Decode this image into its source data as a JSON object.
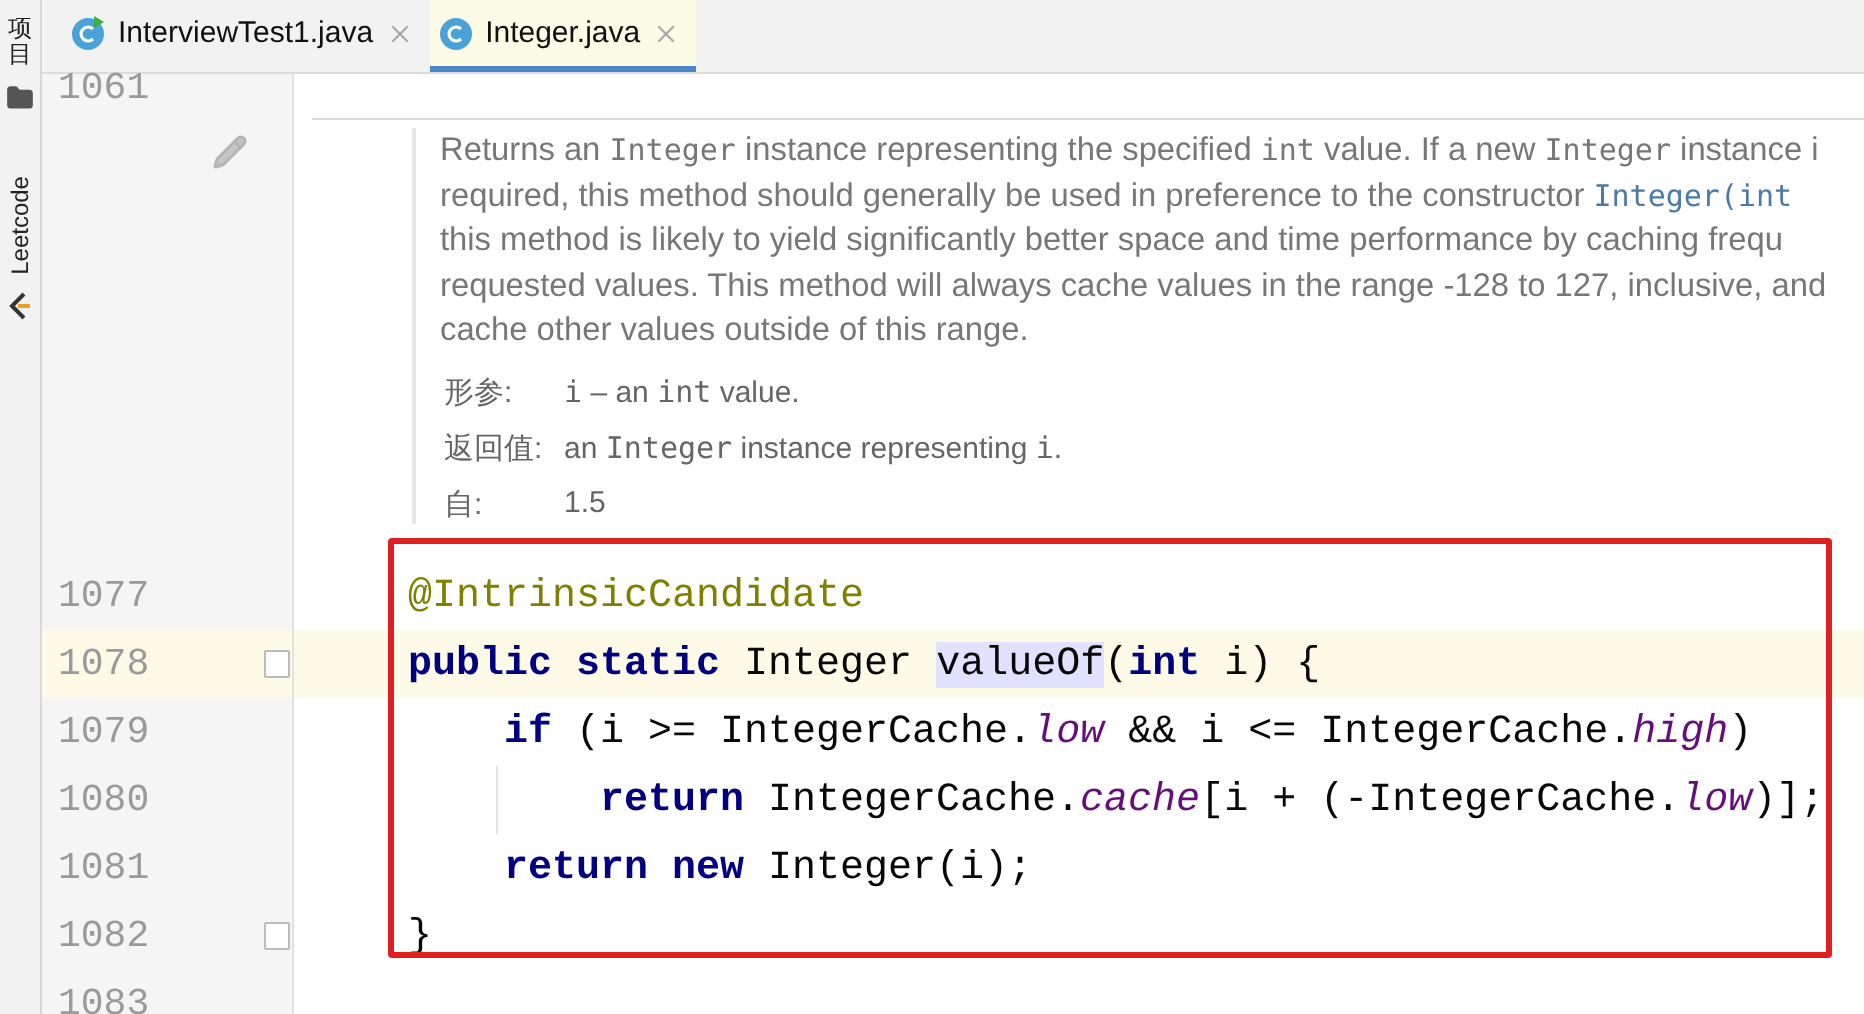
{
  "side_strip": {
    "items": [
      {
        "kind": "cjk",
        "label": "项目"
      },
      {
        "kind": "folder"
      },
      {
        "kind": "latin",
        "label": "Leetcode"
      },
      {
        "kind": "logo"
      }
    ]
  },
  "tabs": [
    {
      "label": "InterviewTest1.java",
      "selected": false
    },
    {
      "label": "Integer.java",
      "selected": true
    }
  ],
  "top_line": {
    "number": "1061"
  },
  "doc": {
    "lines": [
      [
        {
          "kind": "text",
          "text": "Returns an "
        },
        {
          "kind": "code",
          "text": "Integer"
        },
        {
          "kind": "text",
          "text": " instance representing the specified "
        },
        {
          "kind": "code",
          "text": "int"
        },
        {
          "kind": "text",
          "text": " value. If a new "
        },
        {
          "kind": "code",
          "text": "Integer"
        },
        {
          "kind": "text",
          "text": " instance i"
        }
      ],
      [
        {
          "kind": "text",
          "text": "required, this method should generally be used in preference to the constructor "
        },
        {
          "kind": "link",
          "text": "Integer(int"
        }
      ],
      [
        {
          "kind": "text",
          "text": "this method is likely to yield significantly better space and time performance by caching frequ"
        }
      ],
      [
        {
          "kind": "text",
          "text": "requested values. This method will always cache values in the range -128 to 127, inclusive, and"
        }
      ],
      [
        {
          "kind": "text",
          "text": "cache other values outside of this range."
        }
      ]
    ],
    "tags": [
      {
        "label": "形参:",
        "value": [
          {
            "kind": "code",
            "text": "i"
          },
          {
            "kind": "text",
            "text": " – an "
          },
          {
            "kind": "code",
            "text": "int"
          },
          {
            "kind": "text",
            "text": " value."
          }
        ]
      },
      {
        "label": "返回值:",
        "value": [
          {
            "kind": "text",
            "text": "an "
          },
          {
            "kind": "code",
            "text": "Integer"
          },
          {
            "kind": "text",
            "text": " instance representing "
          },
          {
            "kind": "code",
            "text": "i"
          },
          {
            "kind": "text",
            "text": "."
          }
        ]
      },
      {
        "label": "自:",
        "value": [
          {
            "kind": "text",
            "text": "1.5"
          }
        ]
      }
    ]
  },
  "code": {
    "lines": [
      {
        "number": "1077",
        "current": false,
        "fold": false,
        "tokens": [
          {
            "kind": "annotation",
            "text": "@IntrinsicCandidate"
          }
        ]
      },
      {
        "number": "1078",
        "current": true,
        "fold": true,
        "tokens": [
          {
            "kind": "keyword",
            "text": "public static"
          },
          {
            "kind": "plain",
            "text": " Integer "
          },
          {
            "kind": "match",
            "text": "valueOf"
          },
          {
            "kind": "plain",
            "text": "("
          },
          {
            "kind": "keyword",
            "text": "int"
          },
          {
            "kind": "plain",
            "text": " i) {"
          }
        ]
      },
      {
        "number": "1079",
        "current": false,
        "fold": false,
        "kind": "statement",
        "tokens": [
          {
            "kind": "keyword",
            "text": "if"
          },
          {
            "kind": "plain",
            "text": " (i >= IntegerCache."
          },
          {
            "kind": "field",
            "text": "low"
          },
          {
            "kind": "plain",
            "text": " && i <= IntegerCache."
          },
          {
            "kind": "field",
            "text": "high"
          },
          {
            "kind": "plain",
            "text": ")"
          }
        ]
      },
      {
        "number": "1080",
        "current": false,
        "fold": false,
        "kind": "nested_statement",
        "tokens": [
          {
            "kind": "keyword",
            "text": "return"
          },
          {
            "kind": "plain",
            "text": " IntegerCache."
          },
          {
            "kind": "field",
            "text": "cache"
          },
          {
            "kind": "plain",
            "text": "[i + (-IntegerCache."
          },
          {
            "kind": "field",
            "text": "low"
          },
          {
            "kind": "plain",
            "text": ")];"
          }
        ]
      },
      {
        "number": "1081",
        "current": false,
        "fold": false,
        "kind": "statement",
        "tokens": [
          {
            "kind": "keyword",
            "text": "return new"
          },
          {
            "kind": "plain",
            "text": " Integer(i);"
          }
        ]
      },
      {
        "number": "1082",
        "current": false,
        "fold": true,
        "tokens": [
          {
            "kind": "plain",
            "text": "}"
          }
        ]
      },
      {
        "number": "1083",
        "current": false,
        "fold": false
      }
    ]
  }
}
